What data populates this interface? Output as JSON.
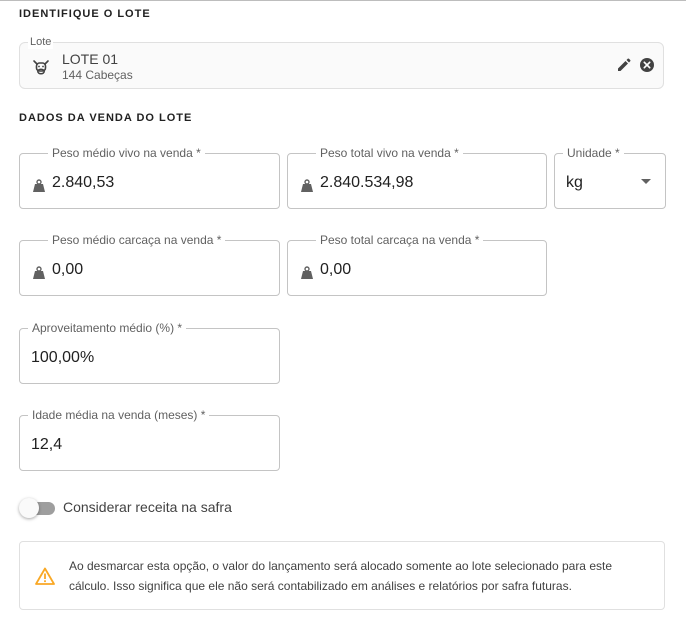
{
  "identify_section": {
    "title": "IDENTIFIQUE O LOTE"
  },
  "lote": {
    "label": "Lote",
    "name": "LOTE 01",
    "count": "144 Cabeças",
    "icon": "cow-icon"
  },
  "sale_section": {
    "title": "DADOS DA VENDA DO LOTE"
  },
  "fields": {
    "peso_medio_vivo": {
      "label": "Peso médio vivo na venda *",
      "value": "2.840,53"
    },
    "peso_total_vivo": {
      "label": "Peso total vivo na venda *",
      "value": "2.840.534,98"
    },
    "unidade": {
      "label": "Unidade *",
      "value": "kg"
    },
    "peso_medio_carcaca": {
      "label": "Peso médio carcaça na venda *",
      "value": "0,00"
    },
    "peso_total_carcaca": {
      "label": "Peso total carcaça na venda *",
      "value": "0,00"
    },
    "aproveitamento": {
      "label": "Aproveitamento médio (%) *",
      "value": "100,00%"
    },
    "idade": {
      "label": "Idade média na venda (meses) *",
      "value": "12,4"
    }
  },
  "toggle": {
    "label": "Considerar receita na safra",
    "checked": false
  },
  "warning": {
    "icon": "warning-icon",
    "color": "#f9a825",
    "text": "Ao desmarcar esta opção, o valor do lançamento será alocado somente ao lote selecionado para este cálculo. Isso significa que ele não será contabilizado em análises e relatórios por safra futuras."
  }
}
